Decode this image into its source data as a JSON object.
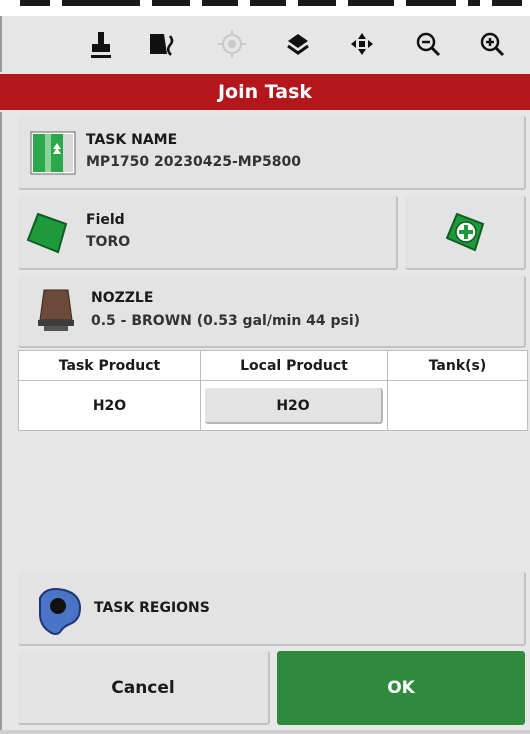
{
  "toolbar": {
    "icons": [
      "touch-pointer-icon",
      "field-boundary-icon",
      "gps-target-icon",
      "layers-icon",
      "pan-arrows-icon",
      "zoom-out-icon",
      "zoom-in-icon"
    ]
  },
  "dialog": {
    "title": "Join Task"
  },
  "task": {
    "label": "TASK NAME",
    "value": "MP1750 20230425-MP5800"
  },
  "field": {
    "label": "Field",
    "value": "TORO"
  },
  "nozzle": {
    "label": "NOZZLE",
    "value": "0.5 - BROWN (0.53 gal/min 44 psi)"
  },
  "products": {
    "headers": [
      "Task Product",
      "Local Product",
      "Tank(s)"
    ],
    "rows": [
      {
        "task_product": "H2O",
        "local_product": "H2O",
        "tanks": ""
      }
    ]
  },
  "regions": {
    "label": "TASK REGIONS"
  },
  "actions": {
    "cancel": "Cancel",
    "ok": "OK"
  },
  "colors": {
    "title_bar": "#b3171b",
    "ok_button": "#2e8b3d",
    "panel": "#e3e3e3"
  }
}
